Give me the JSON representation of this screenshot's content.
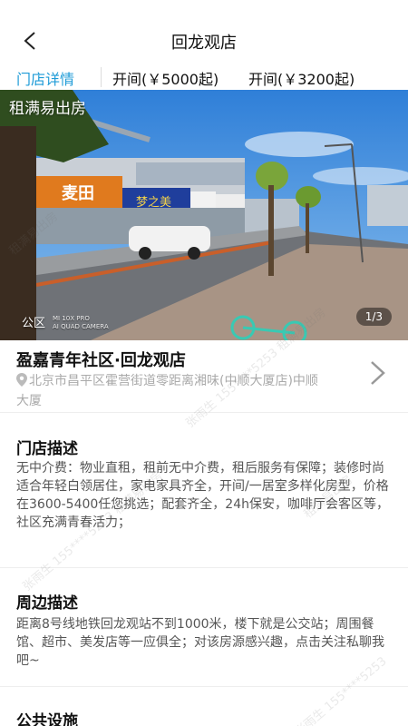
{
  "header": {
    "title": "回龙观店"
  },
  "tabs": [
    {
      "label": "门店详情",
      "active": true
    },
    {
      "label": "开间(￥5000起)",
      "active": false
    },
    {
      "label": "开间(￥3200起)",
      "active": false
    }
  ],
  "hero": {
    "watermark": "租满易出房",
    "counter": "1/3",
    "tag": "公区",
    "camera_line1": "MI 10X PRO",
    "camera_line2": "AI QUAD CAMERA",
    "shop_sign_1": "麦田",
    "shop_sign_2": "梦之美"
  },
  "store": {
    "name": "盈嘉青年社区·回龙观店",
    "address": "北京市昌平区霍营街道零距离湘味(中顺大厦店)中顺大厦"
  },
  "sections": [
    {
      "title": "门店描述",
      "body": "无中介费：物业直租，租前无中介费，租后服务有保障；装修时尚适合年轻白领居住，家电家具齐全，开间/一居室多样化房型，价格在3600-5400任您挑选；配套齐全，24h保安，咖啡厅会客区等，社区充满青春活力；"
    },
    {
      "title": "周边描述",
      "body": "距离8号线地铁回龙观站不到1000米，楼下就是公交站；周围餐馆、超市、美发店等一应俱全；对该房源感兴趣，点击关注私聊我吧~"
    },
    {
      "title": "公共设施",
      "body": ""
    }
  ],
  "watermarks": [
    "张雨生 155****5253 租满易出房",
    "租满易出房",
    "张雨生 155****5253"
  ],
  "colors": {
    "accent": "#1e9bd7",
    "text_primary": "#111111",
    "text_secondary": "#555555",
    "text_muted": "#aaaaaa"
  },
  "icons": {
    "back": "chevron-left-icon",
    "location": "location-pin-icon",
    "address_arrow": "chevron-right-icon"
  }
}
